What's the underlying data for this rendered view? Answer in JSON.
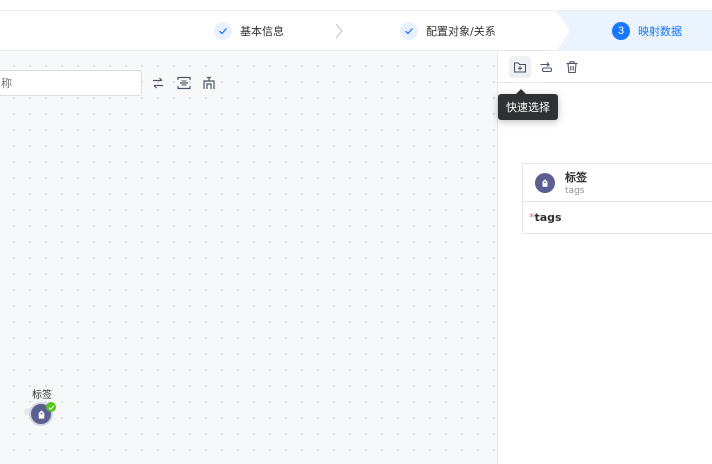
{
  "steps": [
    {
      "label": "基本信息",
      "state": "done"
    },
    {
      "label": "配置对象/关系",
      "state": "done"
    },
    {
      "label": "映射数据",
      "state": "active",
      "number": "3"
    }
  ],
  "canvas": {
    "search_placeholder": "称",
    "tools": [
      "swap-icon",
      "fit-view-icon",
      "layout-icon"
    ],
    "node": {
      "label": "标签",
      "icon": "tag-icon",
      "status": "success"
    }
  },
  "panel": {
    "toolbar": [
      "add-folder-icon",
      "toggle-icon",
      "trash-icon"
    ],
    "tooltip": "快速选择",
    "entity": {
      "name": "标签",
      "sub": "tags",
      "icon": "tag-icon"
    },
    "field": {
      "required_mark": "*",
      "name": "tags"
    }
  },
  "colors": {
    "accent": "#1677ff",
    "node": "#5b5f8f",
    "success": "#52c41a",
    "required": "#f56c6c"
  }
}
